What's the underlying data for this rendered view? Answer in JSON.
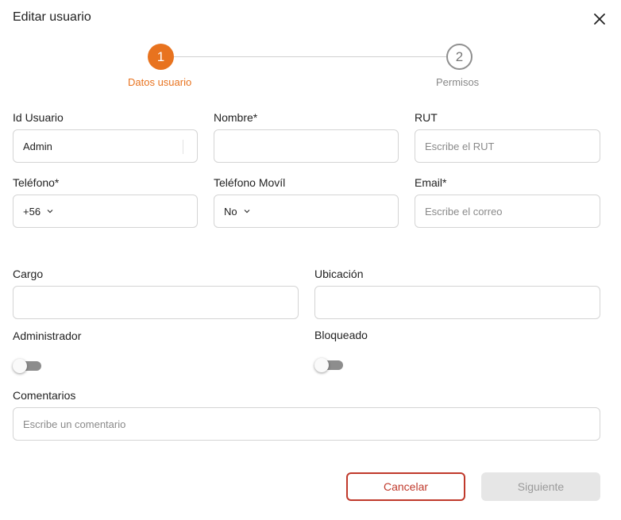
{
  "dialog": {
    "title": "Editar usuario",
    "close_icon": "close-icon"
  },
  "stepper": {
    "steps": [
      {
        "number": "1",
        "label": "Datos usuario",
        "active": true
      },
      {
        "number": "2",
        "label": "Permisos",
        "active": false
      }
    ],
    "active_color": "#e8731f"
  },
  "form": {
    "id_usuario": {
      "label": "Id Usuario",
      "value": "Admin"
    },
    "nombre": {
      "label": "Nombre*",
      "value": ""
    },
    "rut": {
      "label": "RUT",
      "placeholder": "Escribe el RUT"
    },
    "telefono": {
      "label": "Teléfono*",
      "code": "+56"
    },
    "telefono_movil": {
      "label": "Teléfono Movíl",
      "value": "No"
    },
    "email": {
      "label": "Email*",
      "placeholder": "Escribe el correo"
    },
    "cargo": {
      "label": "Cargo",
      "value": ""
    },
    "ubicacion": {
      "label": "Ubicación",
      "value": ""
    },
    "administrador": {
      "label": "Administrador",
      "on": false
    },
    "bloqueado": {
      "label": "Bloqueado",
      "on": false
    },
    "comentarios": {
      "label": "Comentarios",
      "placeholder": "Escribe un comentario"
    }
  },
  "actions": {
    "cancel_label": "Cancelar",
    "next_label": "Siguiente",
    "cancel_color": "#c0392b"
  }
}
